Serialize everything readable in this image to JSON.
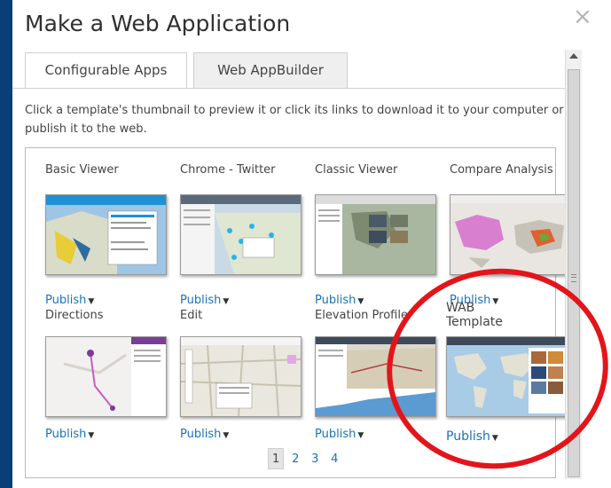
{
  "dialog": {
    "title": "Make a Web Application",
    "close_glyph": "×"
  },
  "tabs": [
    {
      "label": "Configurable Apps",
      "active": true
    },
    {
      "label": "Web AppBuilder",
      "active": false
    }
  ],
  "instructions": "Click a template's thumbnail to preview it or click its links to download it to your computer or publish it to the web.",
  "templates": [
    {
      "title": "Basic Viewer",
      "publish_label": "Publish"
    },
    {
      "title": "Chrome - Twitter",
      "publish_label": "Publish"
    },
    {
      "title": "Classic Viewer",
      "publish_label": "Publish"
    },
    {
      "title": "Compare Analysis",
      "publish_label": "Publish"
    },
    {
      "title": "Directions",
      "publish_label": "Publish"
    },
    {
      "title": "Edit",
      "publish_label": "Publish"
    },
    {
      "title": "Elevation Profile",
      "publish_label": "Publish"
    },
    {
      "title": "WAB Template",
      "publish_label": "Publish"
    }
  ],
  "pagination": {
    "pages": [
      "1",
      "2",
      "3",
      "4"
    ],
    "current": "1"
  },
  "colors": {
    "background": "#0a3e78",
    "link": "#1873b8",
    "highlight": "#e3151a"
  }
}
